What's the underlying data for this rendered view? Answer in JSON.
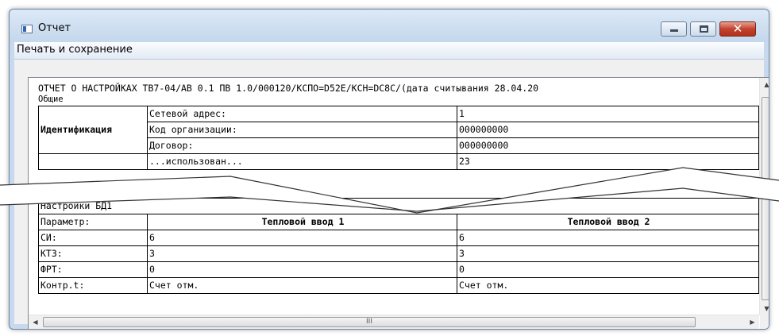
{
  "window": {
    "title": "Отчет",
    "icon": "app-window-icon"
  },
  "menu": {
    "items": [
      {
        "label": "Печать и сохранение"
      }
    ]
  },
  "report": {
    "title": "ОТЧЕТ О НАСТРОЙКАХ ТВ7-04/АВ 0.1 ПВ 1.0/000120/КСПО=D52E/КСН=DC8C/(дата считывания 28.04.20",
    "section_general": "Общие",
    "identification": {
      "group": "Идентификация",
      "rows": [
        {
          "label": "Сетевой адрес:",
          "value": "1"
        },
        {
          "label": "Код организации:",
          "value": "000000000"
        },
        {
          "label": "Договор:",
          "value": "000000000"
        }
      ],
      "partial_row": {
        "label": "...использован...",
        "value": "23"
      }
    },
    "section_bd1": "Настройки БД1",
    "bd1_table": {
      "headers": [
        "Параметр:",
        "Тепловой ввод 1",
        "Тепловой ввод 2"
      ],
      "rows": [
        [
          "СИ:",
          "6",
          "6"
        ],
        [
          "КТ3:",
          "3",
          "3"
        ],
        [
          "ФРТ:",
          "0",
          "0"
        ],
        [
          "Контр.t:",
          "Счет отм.",
          "Счет отм."
        ]
      ]
    }
  },
  "scrollbar": {
    "h_grip": "III"
  }
}
